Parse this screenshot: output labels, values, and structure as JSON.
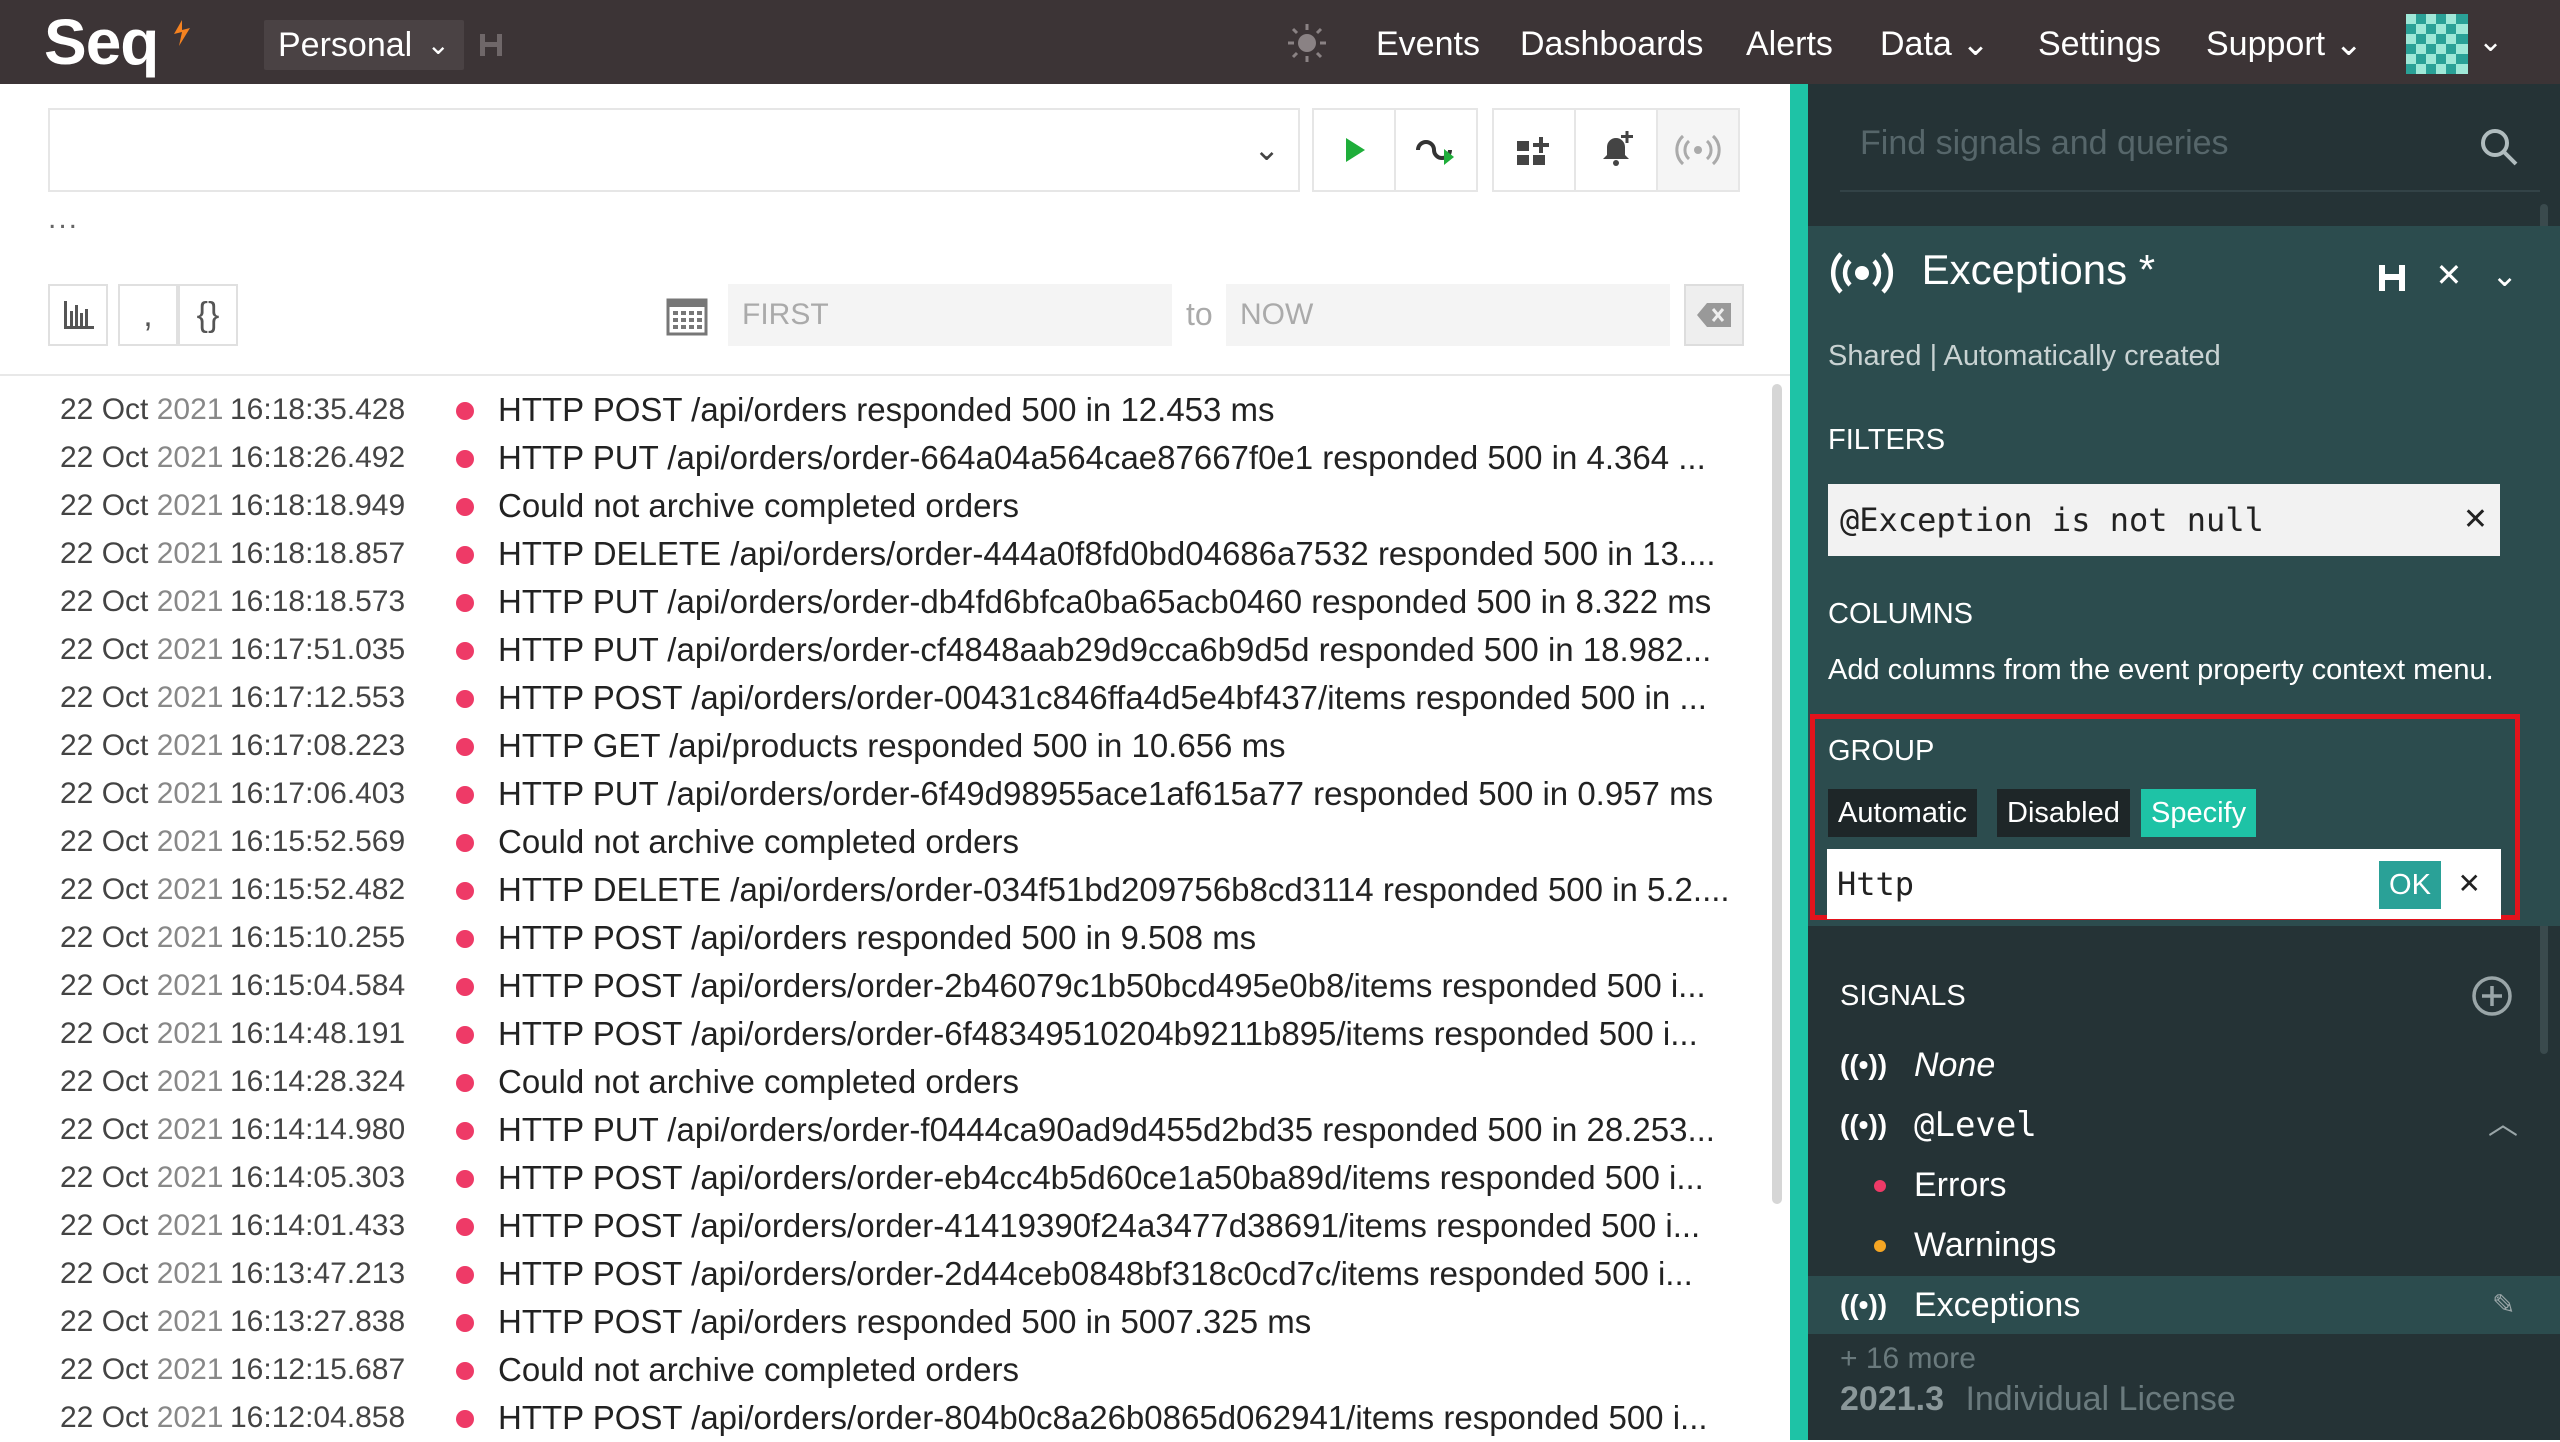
{
  "app": {
    "logo": "Seq",
    "workspace": "Personal"
  },
  "nav": {
    "events": "Events",
    "dashboards": "Dashboards",
    "alerts": "Alerts",
    "data": "Data",
    "settings": "Settings",
    "support": "Support"
  },
  "query": {
    "value": "",
    "ellipsis": "..."
  },
  "range": {
    "from_placeholder": "FIRST",
    "to_label": "to",
    "to_placeholder": "NOW"
  },
  "events": [
    {
      "date": "22 Oct",
      "year": "2021",
      "time": "16:18:35.428",
      "message": "HTTP POST /api/orders responded 500 in 12.453 ms"
    },
    {
      "date": "22 Oct",
      "year": "2021",
      "time": "16:18:26.492",
      "message": "HTTP PUT /api/orders/order-664a04a564cae87667f0e1 responded 500 in 4.364 ..."
    },
    {
      "date": "22 Oct",
      "year": "2021",
      "time": "16:18:18.949",
      "message": "Could not archive completed orders"
    },
    {
      "date": "22 Oct",
      "year": "2021",
      "time": "16:18:18.857",
      "message": "HTTP DELETE /api/orders/order-444a0f8fd0bd04686a7532 responded 500 in 13...."
    },
    {
      "date": "22 Oct",
      "year": "2021",
      "time": "16:18:18.573",
      "message": "HTTP PUT /api/orders/order-db4fd6bfca0ba65acb0460 responded 500 in 8.322 ms"
    },
    {
      "date": "22 Oct",
      "year": "2021",
      "time": "16:17:51.035",
      "message": "HTTP PUT /api/orders/order-cf4848aab29d9cca6b9d5d responded 500 in 18.982..."
    },
    {
      "date": "22 Oct",
      "year": "2021",
      "time": "16:17:12.553",
      "message": "HTTP POST /api/orders/order-00431c846ffa4d5e4bf437/items responded 500 in ..."
    },
    {
      "date": "22 Oct",
      "year": "2021",
      "time": "16:17:08.223",
      "message": "HTTP GET /api/products responded 500 in 10.656 ms"
    },
    {
      "date": "22 Oct",
      "year": "2021",
      "time": "16:17:06.403",
      "message": "HTTP PUT /api/orders/order-6f49d98955ace1af615a77 responded 500 in 0.957 ms"
    },
    {
      "date": "22 Oct",
      "year": "2021",
      "time": "16:15:52.569",
      "message": "Could not archive completed orders"
    },
    {
      "date": "22 Oct",
      "year": "2021",
      "time": "16:15:52.482",
      "message": "HTTP DELETE /api/orders/order-034f51bd209756b8cd3114 responded 500 in 5.2...."
    },
    {
      "date": "22 Oct",
      "year": "2021",
      "time": "16:15:10.255",
      "message": "HTTP POST /api/orders responded 500 in 9.508 ms"
    },
    {
      "date": "22 Oct",
      "year": "2021",
      "time": "16:15:04.584",
      "message": "HTTP POST /api/orders/order-2b46079c1b50bcd495e0b8/items responded 500 i..."
    },
    {
      "date": "22 Oct",
      "year": "2021",
      "time": "16:14:48.191",
      "message": "HTTP POST /api/orders/order-6f48349510204b9211b895/items responded 500 i..."
    },
    {
      "date": "22 Oct",
      "year": "2021",
      "time": "16:14:28.324",
      "message": "Could not archive completed orders"
    },
    {
      "date": "22 Oct",
      "year": "2021",
      "time": "16:14:14.980",
      "message": "HTTP PUT /api/orders/order-f0444ca90ad9d455d2bd35 responded 500 in 28.253..."
    },
    {
      "date": "22 Oct",
      "year": "2021",
      "time": "16:14:05.303",
      "message": "HTTP POST /api/orders/order-eb4cc4b5d60ce1a50ba89d/items responded 500 i..."
    },
    {
      "date": "22 Oct",
      "year": "2021",
      "time": "16:14:01.433",
      "message": "HTTP POST /api/orders/order-41419390f24a3477d38691/items responded 500 i..."
    },
    {
      "date": "22 Oct",
      "year": "2021",
      "time": "16:13:47.213",
      "message": "HTTP POST /api/orders/order-2d44ceb0848bf318c0cd7c/items responded 500 i..."
    },
    {
      "date": "22 Oct",
      "year": "2021",
      "time": "16:13:27.838",
      "message": "HTTP POST /api/orders responded 500 in 5007.325 ms"
    },
    {
      "date": "22 Oct",
      "year": "2021",
      "time": "16:12:15.687",
      "message": "Could not archive completed orders"
    },
    {
      "date": "22 Oct",
      "year": "2021",
      "time": "16:12:04.858",
      "message": "HTTP POST /api/orders/order-804b0c8a26b0865d062941/items responded 500 i..."
    }
  ],
  "sidebar": {
    "search_placeholder": "Find signals and queries",
    "signal": {
      "title": "Exceptions *",
      "subtitle": "Shared | Automatically created",
      "filters_label": "FILTERS",
      "filter_expr": "@Exception is not null",
      "columns_label": "COLUMNS",
      "columns_text": "Add columns from the event property context menu.",
      "group_label": "GROUP",
      "group_modes": [
        "Automatic",
        "Disabled",
        "Specify"
      ],
      "group_value": "Http",
      "ok_label": "OK"
    },
    "signals_label": "SIGNALS",
    "signals": {
      "none": "None",
      "level": "@Level",
      "errors": "Errors",
      "warnings": "Warnings",
      "exceptions": "Exceptions"
    },
    "more": "+ 16 more",
    "version": "2021.3",
    "license": "Individual License"
  },
  "colors": {
    "topbar": "#3c3436",
    "accent": "#1ec3a6",
    "error_dot": "#ee3a67",
    "warning_dot": "#f5a623",
    "panel": "#2c4c4e",
    "highlight_border": "#e3131c"
  },
  "icons": [
    "seq-flame-icon",
    "save-icon",
    "theme-icon",
    "chevron-down-icon",
    "play-icon",
    "refresh-icon",
    "add-dashboard-icon",
    "add-alert-icon",
    "signal-icon",
    "chart-icon",
    "quote-icon",
    "braces-icon",
    "calendar-icon",
    "backspace-icon",
    "search-icon",
    "close-icon",
    "plus-circle-icon",
    "pencil-icon"
  ]
}
